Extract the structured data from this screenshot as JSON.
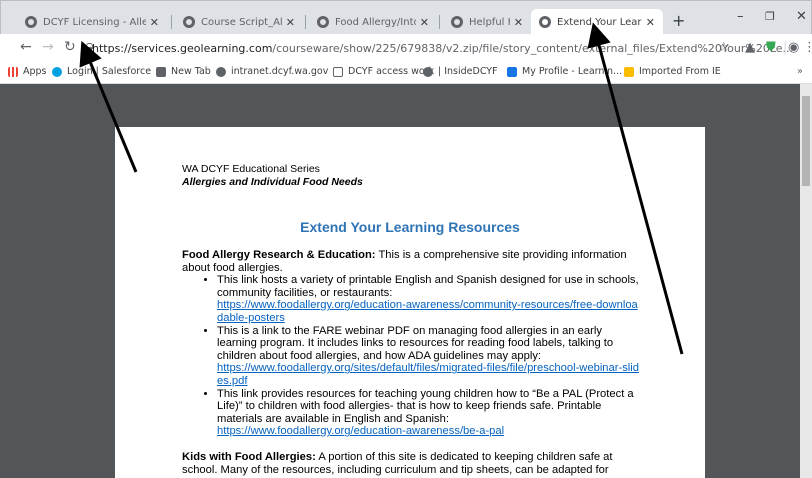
{
  "tabs": [
    {
      "title": "DCYF Licensing - Alle",
      "active": false
    },
    {
      "title": "Course Script_Allergi",
      "active": false
    },
    {
      "title": "Food Allergy/Intoleran",
      "active": false
    },
    {
      "title": "Helpful Hints.pdf",
      "active": false
    },
    {
      "title": "Extend Your Learning",
      "active": true
    }
  ],
  "toolbar": {
    "url_host": "https://services.geolearning.com",
    "url_path": "/courseware/show/225/679838/v2.zip/file/story_content/external_files/Extend%20Your%20Le..."
  },
  "bookmarks": [
    {
      "label": "Apps",
      "color": "#ea4335"
    },
    {
      "label": "Login | Salesforce",
      "color": "#00a1e0"
    },
    {
      "label": "New Tab",
      "color": "#5f6368"
    },
    {
      "label": "intranet.dcyf.wa.gov",
      "color": "#5f6368"
    },
    {
      "label": "DCYF access work",
      "color": "#5f6368"
    },
    {
      "label": "| InsideDCYF",
      "color": "#5f6368"
    },
    {
      "label": "My Profile - Learnin...",
      "color": "#1a73e8"
    },
    {
      "label": "Imported From IE",
      "color": "#fbbc04"
    }
  ],
  "document": {
    "header_line1": "WA DCYF Educational Series",
    "header_line2": "Allergies and Individual Food Needs",
    "title": "Extend Your Learning Resources",
    "section1": {
      "heading": "Food Allergy Research & Education:",
      "text": " This is a comprehensive site providing information about food allergies.",
      "items": [
        {
          "text": "This link hosts a variety of printable English and Spanish designed for use in schools, community facilities, or restaurants:",
          "link": "https://www.foodallergy.org/education-awareness/community-resources/free-downloadable-posters"
        },
        {
          "text": "This is a link to the FARE webinar PDF on managing food allergies in an early learning program. It includes links to resources for reading food labels, talking to children about food allergies, and how ADA guidelines may apply:",
          "link": "https://www.foodallergy.org/sites/default/files/migrated-files/file/preschool-webinar-slides.pdf"
        },
        {
          "text": "This link provides resources for teaching young children how to “Be a PAL (Protect a Life)” to children with food allergies- that is how to keep friends safe. Printable materials are available in English and Spanish:",
          "link": "https://www.foodallergy.org/education-awareness/be-a-pal"
        }
      ]
    },
    "section2": {
      "heading": "Kids with Food Allergies:",
      "text": " A portion of this site is dedicated to keeping children safe at school. Many of the resources, including curriculum and tip sheets, can be adapted for"
    }
  },
  "colors": {
    "link": "#0563c1",
    "title": "#2e74b5",
    "viewer_bg": "#525659",
    "tabstrip_bg": "#dee1e6"
  }
}
